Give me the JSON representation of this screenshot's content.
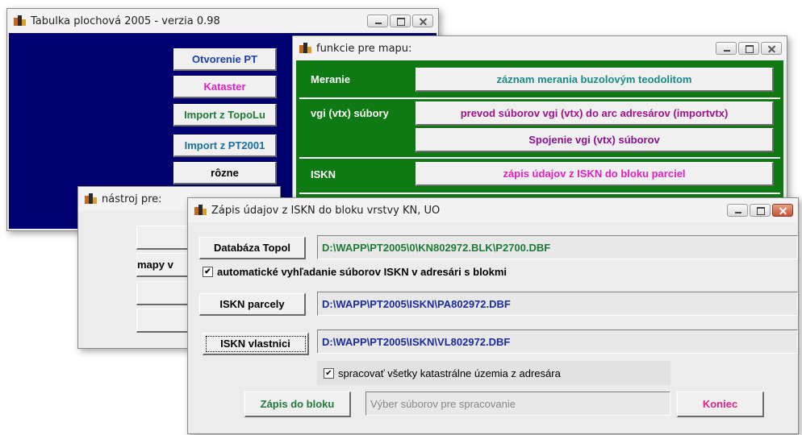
{
  "win1": {
    "title": "Tabulka plochová 2005 - verzia 0.98",
    "buttons": [
      {
        "label": "Otvorenie PT",
        "color": "#1a3fb0"
      },
      {
        "label": "Kataster",
        "color": "#e020c0"
      },
      {
        "label": "Import z TopoLu",
        "color": "#1f7a3a"
      },
      {
        "label": "Import z PT2001",
        "color": "#1a6fa0"
      },
      {
        "label": "rôzne",
        "color": "#000000"
      }
    ],
    "bg": "#000070"
  },
  "win2": {
    "title": "funkcie pre mapu:",
    "bg": "#0f7a14",
    "sections": {
      "meranie": "Meranie",
      "vgi": "vgi (vtx) súbory",
      "iskn": "ISKN"
    },
    "buttons": {
      "zaznam": {
        "label": "záznam merania buzolovým teodolitom",
        "color": "#1a8a8a"
      },
      "prevod": {
        "label": "prevod súborov vgi (vtx) do arc adresárov (importvtx)",
        "color": "#a0108a"
      },
      "spojenie": {
        "label": "Spojenie vgi (vtx) súborov",
        "color": "#8a1090"
      },
      "zapis": {
        "label": "zápis údajov z ISKN do bloku parciel",
        "color": "#e020c0"
      }
    }
  },
  "win3": {
    "title": "nástroj pre:",
    "partial_button": "mapy v"
  },
  "win4": {
    "title": "Zápis údajov z ISKN  do bloku vrstvy KN, UO",
    "db_button": "Databáza Topol",
    "db_path": "D:\\WAPP\\PT2005\\0\\KN802972.BLK\\P2700.DBF",
    "db_path_color": "#1f7a3a",
    "auto_check": "automatické vyhľadanie súborov ISKN v adresári  s blokmi",
    "parcely_button": "ISKN parcely",
    "parcely_path": "D:\\WAPP\\PT2005\\ISKN\\PA802972.DBF",
    "vlastnici_button": "ISKN vlastnici",
    "vlastnici_path": "D:\\WAPP\\PT2005\\ISKN\\VL802972.DBF",
    "path_color": "#1a2aa0",
    "all_check": "spracovať všetky katastrálne územia z adresára",
    "zapis_button": "Zápis do bloku",
    "zapis_color": "#1f7a3a",
    "status_placeholder": "Výber súborov pre spracovanie",
    "koniec_button": "Koniec",
    "koniec_color": "#e0208a"
  }
}
